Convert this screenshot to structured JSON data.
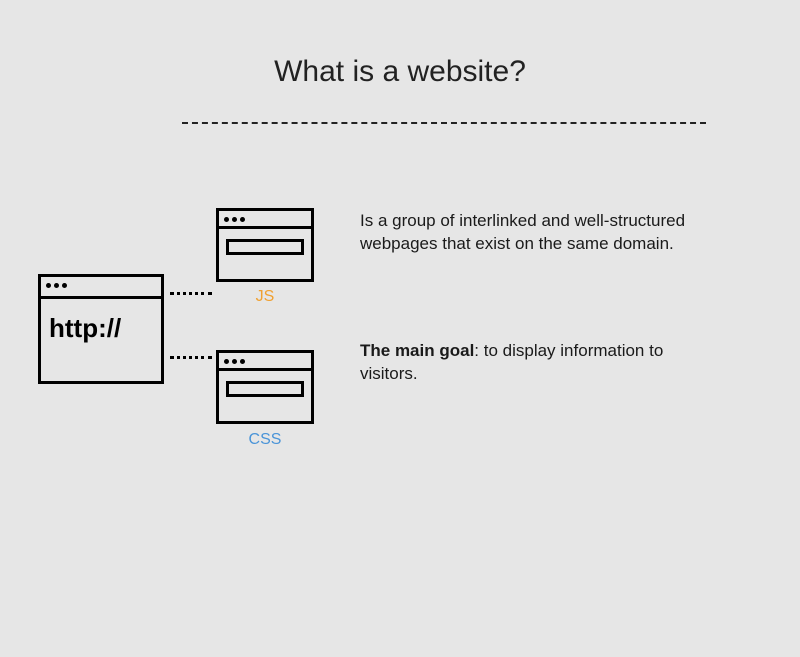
{
  "title": "What is a website?",
  "main_window": {
    "protocol_text": "http://"
  },
  "labels": {
    "js": "JS",
    "css": "CSS"
  },
  "paragraphs": {
    "definition": "Is a group of interlinked and well-structured webpages that exist on the same domain.",
    "goal_lead": "The main goal",
    "goal_rest": ": to display information to visitors."
  },
  "colors": {
    "js": "#f0a030",
    "css": "#4a94d8",
    "background": "#e6e6e6"
  }
}
